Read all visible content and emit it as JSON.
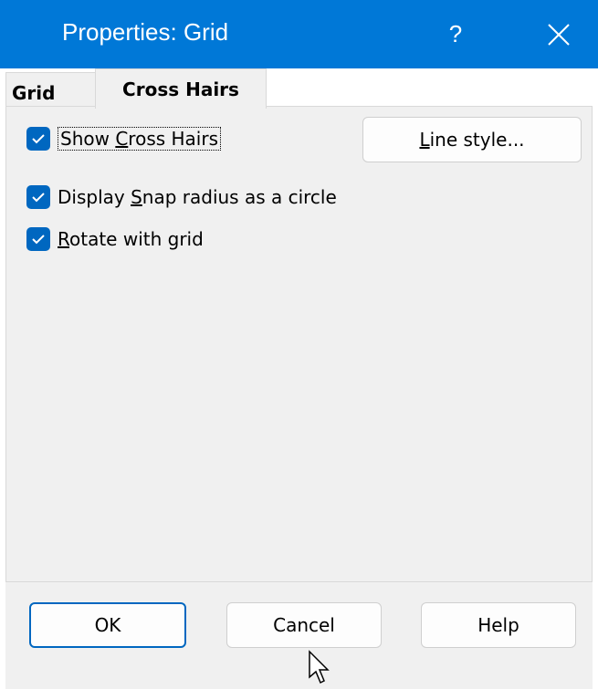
{
  "window": {
    "title": "Properties: Grid",
    "help_label": "?",
    "titlebar_color": "#0078d7"
  },
  "tabs": [
    {
      "label": "Grid",
      "selected": false
    },
    {
      "label": "Cross Hairs",
      "selected": true
    }
  ],
  "options": {
    "show_cross_hairs": {
      "prefix": "Show ",
      "mnemonic": "C",
      "suffix": "ross Hairs",
      "checked": true
    },
    "display_snap": {
      "prefix": "Display ",
      "mnemonic": "S",
      "suffix": "nap radius as a circle",
      "checked": true
    },
    "rotate_with_grid": {
      "prefix": "",
      "mnemonic": "R",
      "suffix": "otate with grid",
      "checked": true
    }
  },
  "line_style_button": {
    "mnemonic": "L",
    "suffix": "ine style..."
  },
  "buttons": {
    "ok": "OK",
    "cancel": "Cancel",
    "help": "Help"
  },
  "icons": {
    "close": "close-icon",
    "checkmark": "checkmark-icon",
    "cursor": "mouse-cursor-icon"
  },
  "colors": {
    "accent": "#0067c0",
    "panel": "#f0f0f0"
  }
}
